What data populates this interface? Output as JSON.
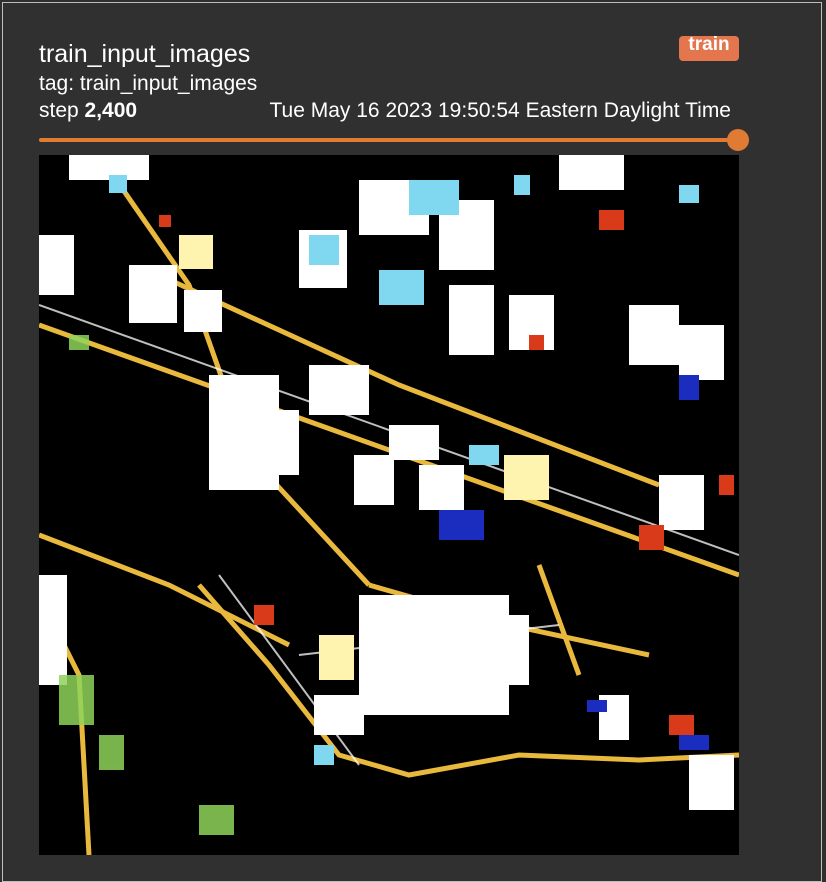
{
  "card": {
    "title": "train_input_images",
    "run_badge": "train",
    "tag_line": "tag: train_input_images",
    "step_prefix": "step",
    "step_value": "2,400",
    "timestamp": "Tue May 16 2023 19:50:54 Eastern Daylight Time",
    "step_slider_fraction": 1.0
  },
  "colors": {
    "background": "#2f2f2f",
    "accent": "#e07b34",
    "badge": "#e3764d",
    "text": "#ffffff"
  },
  "image": {
    "alt": "train_input_images"
  }
}
